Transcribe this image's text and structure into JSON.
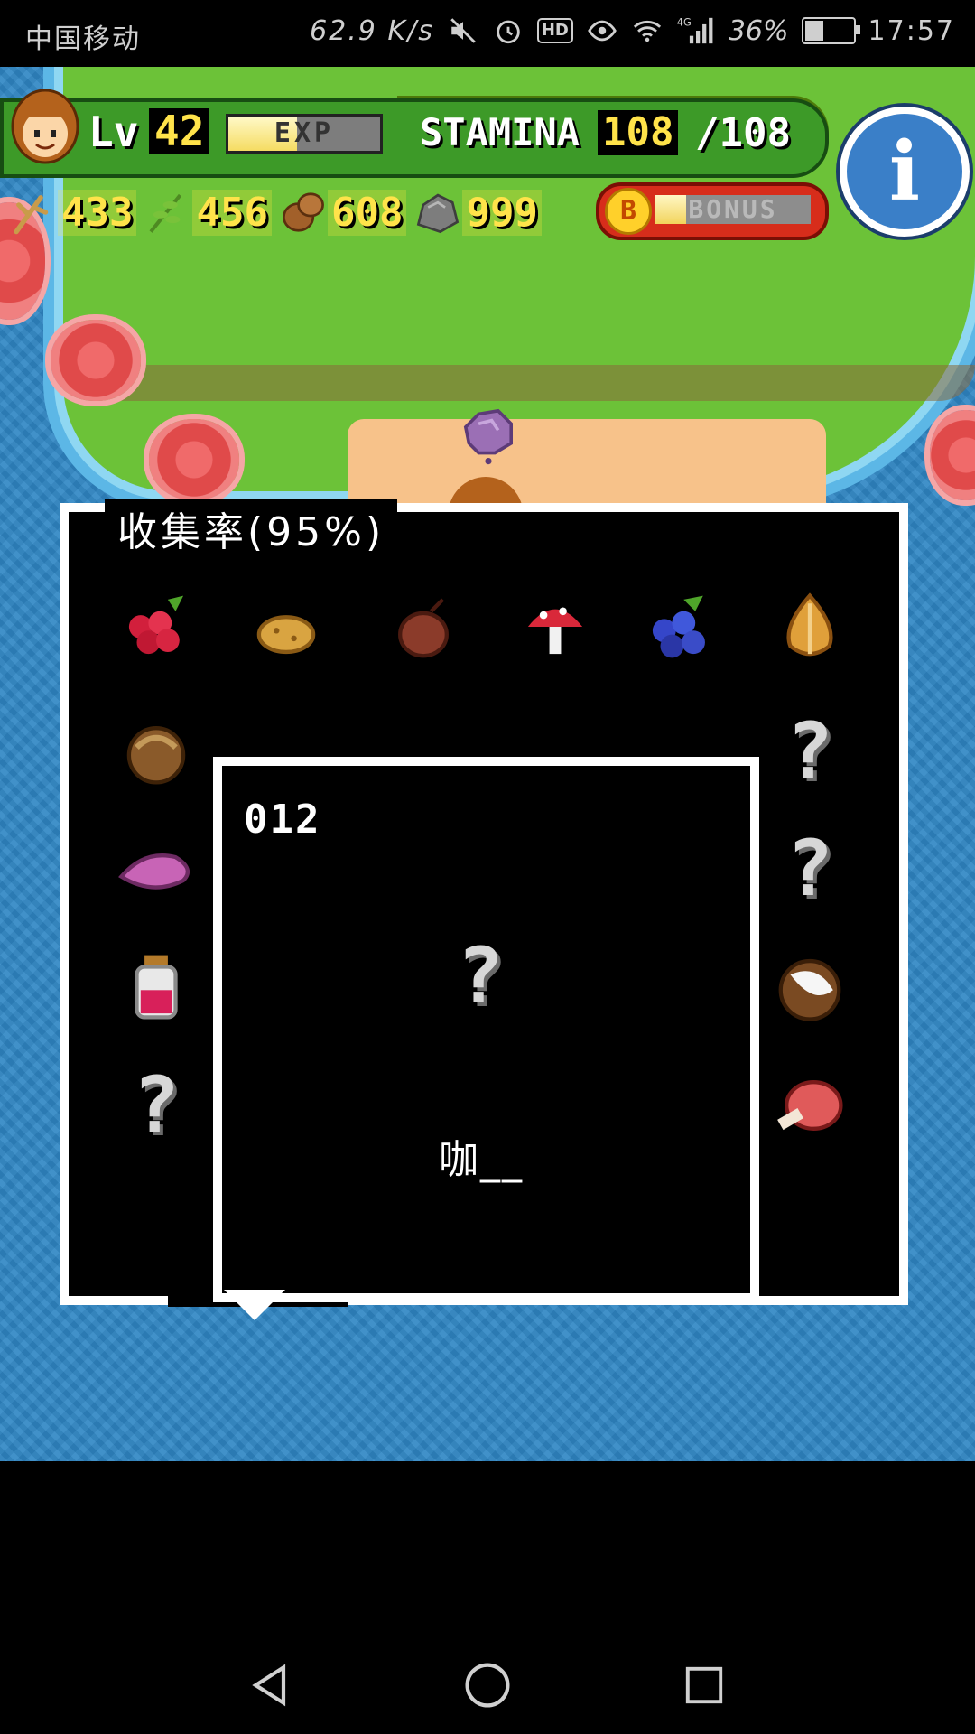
{
  "status_bar": {
    "carrier": "中国移动",
    "net_speed": "62.9 K/s",
    "hd": "HD",
    "signal_label": "4G",
    "battery": "36%",
    "battery_level": 0.36,
    "time": "17:57",
    "icons": [
      "mute-icon",
      "alarm-icon",
      "eye-icon",
      "wifi-icon",
      "signal-icon",
      "battery-icon"
    ]
  },
  "hud": {
    "level_label": "Lv",
    "level": "42",
    "exp_label": "EXP",
    "exp_level": 0.45,
    "stamina_label": "STAMINA",
    "stamina": "108",
    "stamina_max": "/108",
    "info_label": "i"
  },
  "resources": [
    {
      "icon": "branch-icon",
      "value": "433"
    },
    {
      "icon": "herb-icon",
      "value": "456"
    },
    {
      "icon": "nut-icon",
      "value": "608"
    },
    {
      "icon": "stone-icon",
      "value": "999"
    }
  ],
  "bonus": {
    "coin_label": "B",
    "label": "BONUS",
    "level": 0.2
  },
  "collection": {
    "title": "收集率(95%)",
    "items": [
      {
        "icon": "raspberry-icon"
      },
      {
        "icon": "potato-icon"
      },
      {
        "icon": "chestnut-icon"
      },
      {
        "icon": "mushroom-icon"
      },
      {
        "icon": "blueberry-icon"
      },
      {
        "icon": "onion-icon"
      },
      {
        "icon": "acorn-icon"
      },
      {
        "icon": "sweet-potato-icon"
      },
      {
        "icon": "jam-jar-icon"
      },
      {
        "icon": "unknown-icon",
        "text": "?"
      },
      {
        "icon": "unknown-icon",
        "text": "?"
      },
      {
        "icon": "unknown-icon",
        "text": "?"
      },
      {
        "icon": "coconut-icon"
      },
      {
        "icon": "meat-icon"
      }
    ]
  },
  "detail": {
    "number": "012",
    "unknown_mark": "?",
    "name": "咖__"
  },
  "colors": {
    "grass": "#6cc238",
    "water": "#2f86c4",
    "sand": "#f7c28a",
    "stamina": "#a7d82c",
    "hud_green": "#3d9a28",
    "number_yellow": "#ffe34a",
    "bonus_red": "#d72d1b",
    "info_blue": "#3a7fc8"
  },
  "navbar": [
    "back-icon",
    "home-icon",
    "recents-icon"
  ]
}
